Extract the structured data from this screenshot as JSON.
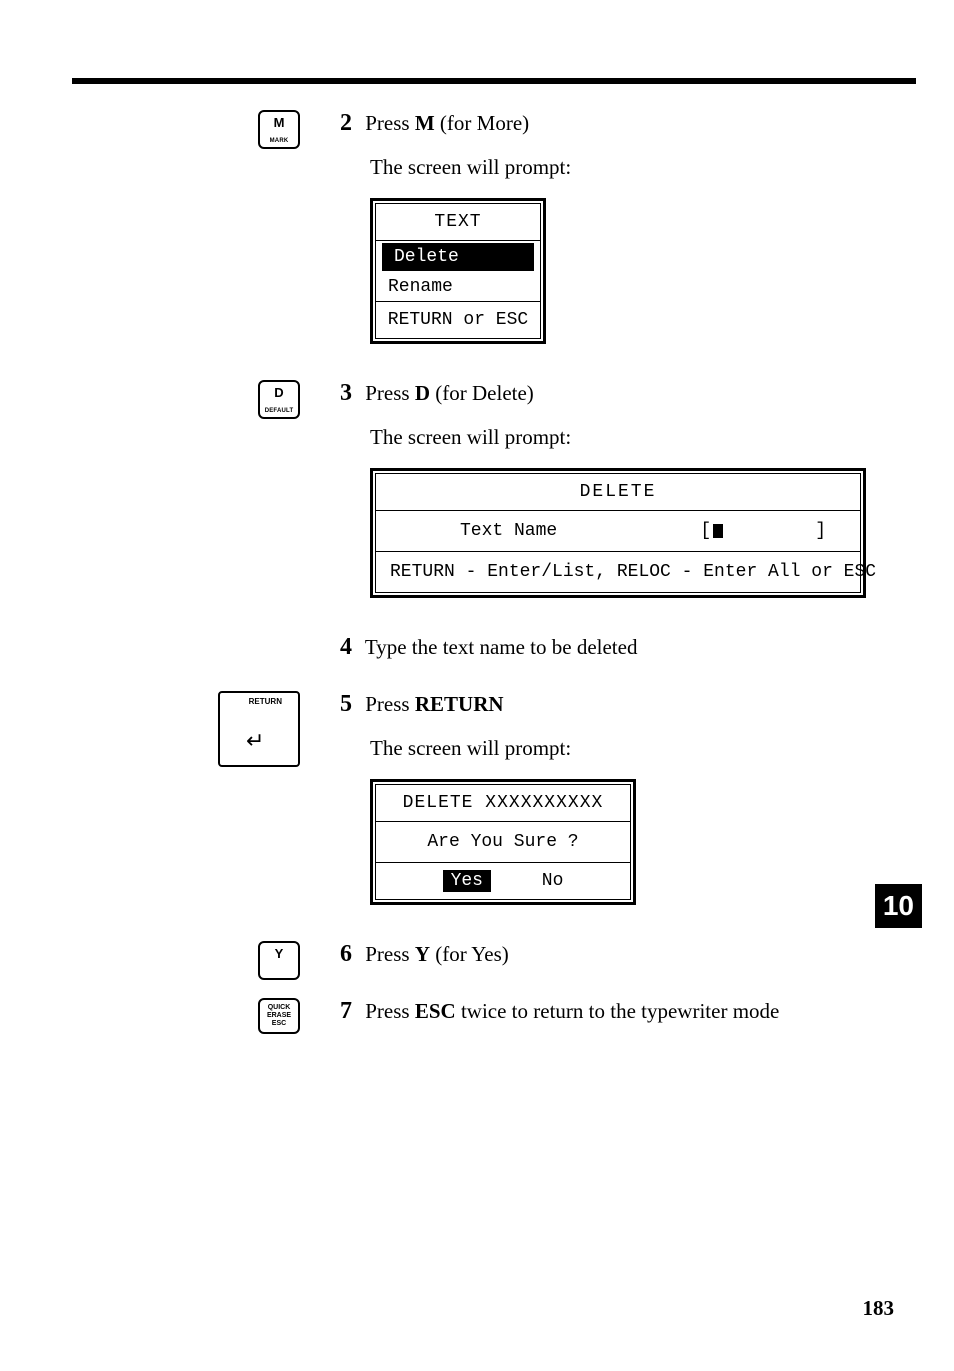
{
  "steps": {
    "s2": {
      "num": "2",
      "prefix": "Press ",
      "key": "M",
      "suffix": " (for More)"
    },
    "s3": {
      "num": "3",
      "prefix": "Press ",
      "key": "D",
      "suffix": " (for Delete)"
    },
    "s4": {
      "num": "4",
      "text": "Type the text name to be deleted"
    },
    "s5": {
      "num": "5",
      "prefix": "Press ",
      "key": "RETURN"
    },
    "s6": {
      "num": "6",
      "prefix": "Press ",
      "key": "Y",
      "suffix": " (for Yes)"
    },
    "s7": {
      "num": "7",
      "prefix": "Press ",
      "key": "ESC",
      "suffix": " twice to return to the typewriter mode"
    }
  },
  "prompt_text": "The screen will prompt:",
  "keycaps": {
    "m": {
      "top": "M",
      "sub": "MARK"
    },
    "d": {
      "top": "D",
      "sub": "DEFAULT"
    },
    "return": {
      "label": "RETURN",
      "arrow": "↵"
    },
    "y": {
      "top": "Y"
    },
    "esc": {
      "l1": "QUICK",
      "l2": "ERASE",
      "l3": "ESC"
    }
  },
  "dialogs": {
    "text_menu": {
      "title": "TEXT",
      "opt_selected": "Delete",
      "opt_other": "Rename",
      "footer": "RETURN or ESC"
    },
    "delete_prompt": {
      "title": "DELETE",
      "field_label": "Text Name",
      "bracket_l": "[",
      "bracket_r": "]",
      "footer": "RETURN - Enter/List, RELOC - Enter All or ESC"
    },
    "confirm": {
      "title_prefix": "DELETE  ",
      "title_name": "XXXXXXXXXX",
      "question": "Are You Sure ?",
      "yes": "Yes",
      "no": "No"
    }
  },
  "section_tab": "10",
  "page_number": "183"
}
